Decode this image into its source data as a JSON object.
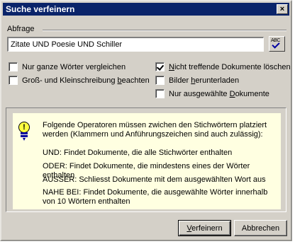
{
  "window": {
    "title": "Suche verfeinern",
    "close_label": "×"
  },
  "query": {
    "label": "Abfrage",
    "value": "Zitate UND Poesie UND Schiller"
  },
  "spellcheck": {
    "text": "ABC",
    "icon": "spellcheck-icon"
  },
  "options": {
    "whole_words": {
      "before": "Nur ",
      "accel": "g",
      "after": "anze Wörter vergleichen",
      "checked": false
    },
    "match_case": {
      "before": "Groß- und Kleinschreibung ",
      "accel": "b",
      "after": "eachten",
      "checked": false
    },
    "exclude_non_matching": {
      "before": "",
      "accel": "N",
      "after": "icht treffende Dokumente löschen",
      "checked": true
    },
    "download_images": {
      "before": "Bilder ",
      "accel": "h",
      "after": "erunterladen",
      "checked": false
    },
    "selected_only": {
      "before": "Nur ausgewählte ",
      "accel": "D",
      "after": "okumente",
      "checked": false
    }
  },
  "info": {
    "icon": "lightbulb-icon",
    "intro": "Folgende Operatoren müssen zwichen den Stichwörtern platziert werden (Klammern und Anführungszeichen sind auch zulässig):",
    "und": "UND: Findet Dokumente, die alle Stichwörter enthalten",
    "oder": "ODER: Findet Dokumente, die mindestens eines der Wörter enthalten",
    "ausser": "AUSSER: Schliesst Dokumente mit dem ausgewählten Wort aus",
    "nahe_bei": "NAHE BEI: Findet Dokumente, die ausgewählte Wörter innerhalb von 10 Wörtern enthalten"
  },
  "buttons": {
    "refine": {
      "accel": "V",
      "rest": "erfeinern"
    },
    "cancel": "Abbrechen"
  }
}
